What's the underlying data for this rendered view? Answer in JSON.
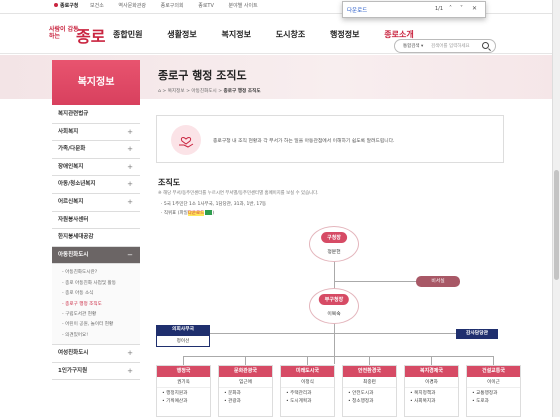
{
  "topbar": {
    "links": [
      "종로구청",
      "보건소",
      "역사문화관광",
      "종로구의회",
      "종로TV",
      "분야별 사이트"
    ]
  },
  "find": {
    "query": "다운로드",
    "count": "1/1",
    "up": "˄",
    "down": "˅",
    "close": "✕"
  },
  "header": {
    "logo_small": "사람이 감동하는",
    "logo_big": "종로",
    "nav": [
      "종합민원",
      "생활정보",
      "복지정보",
      "도시창조",
      "행정정보",
      "종로소개"
    ],
    "search_select": "통합검색 ▾",
    "search_placeholder": "검색어를 입력하세요"
  },
  "sidebar": {
    "title": "복지정보",
    "items": [
      {
        "label": "복지관련법규",
        "plus": false
      },
      {
        "label": "사회복지",
        "plus": true
      },
      {
        "label": "가족/다문화",
        "plus": true
      },
      {
        "label": "장애인복지",
        "plus": true
      },
      {
        "label": "아동/청소년복지",
        "plus": true
      },
      {
        "label": "어르신복지",
        "plus": true
      },
      {
        "label": "자원봉사센터",
        "plus": false
      },
      {
        "label": "한지붕세대공감",
        "plus": false
      },
      {
        "label": "아동친화도시",
        "plus": true
      }
    ],
    "sub_items": [
      "아동친화도시란?",
      "종로 아동친화 사업및 활동",
      "종로 아동 소식",
      "종로구 행정 조직도",
      "구립도서관 현황",
      "어린이 공원, 놀이터 현황",
      "의견있어요!"
    ],
    "items_after": [
      {
        "label": "여성친화도시",
        "plus": true
      },
      {
        "label": "1인가구지원",
        "plus": true
      }
    ]
  },
  "page": {
    "title": "종로구 행정 조직도",
    "breadcrumb": [
      "⌂",
      "복지정보",
      "아동친화도시",
      "종로구 행정 조직도"
    ],
    "intro_text": "종로구청 내 조직 현황과 각 부서가 하는 일을 아동관점에서 이해하기 쉽도록 알려드립니다.",
    "section_title": "조직도",
    "note": "※ 해당 부서/동주민센터를 누르시면 부서별/동주민센터별 홈페이지를 보실 수 있습니다.",
    "bullet1": "5국 1주민단 1소 1사무국, 1담당관, 31과, 1반, 17동",
    "bullet2_prefix": "직위표 (파일",
    "bullet2_highlight": "다운로드",
    "bullet2_suffix": ")"
  },
  "org": {
    "mayor_title": "구청장",
    "mayor_name": "정문헌",
    "secretary": "비서실",
    "deputy_title": "부구청장",
    "deputy_name": "이복숙",
    "council_office": "의회사무국",
    "council_office_head": "정이선",
    "audit": "감사담당관",
    "depts": [
      {
        "title": "행정국",
        "head": "권기옥",
        "items": [
          "행정지원과",
          "기획예산과"
        ]
      },
      {
        "title": "문화관광국",
        "head": "임근애",
        "items": [
          "문화과",
          "관광과"
        ]
      },
      {
        "title": "미래도시국",
        "head": "이정식",
        "items": [
          "주택관리과",
          "도시계획과"
        ]
      },
      {
        "title": "안전환경국",
        "head": "최중련",
        "items": [
          "안전도시과",
          "청소행정과"
        ]
      },
      {
        "title": "복지경제국",
        "head": "이경자",
        "items": [
          "복지정책과",
          "사회복지과"
        ]
      },
      {
        "title": "건설교통국",
        "head": "이이근",
        "items": [
          "교통행정과",
          "도로과"
        ]
      }
    ]
  }
}
